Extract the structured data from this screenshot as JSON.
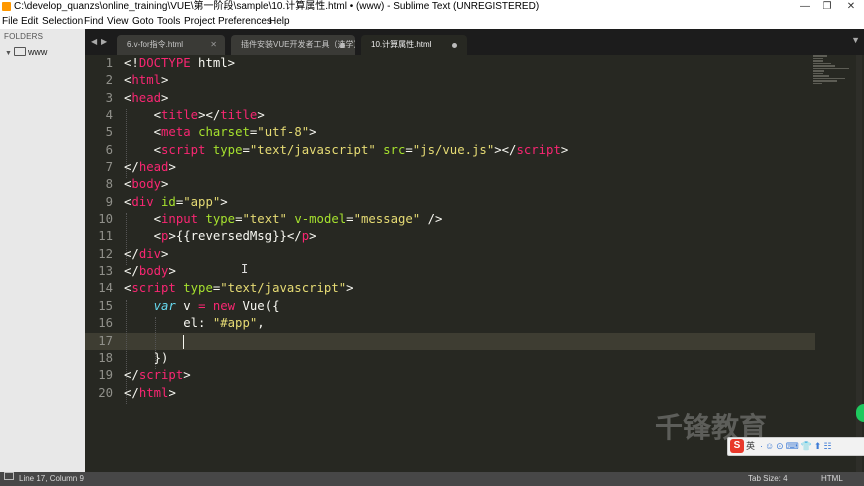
{
  "window": {
    "title": "C:\\develop_quanzs\\online_training\\VUE\\第一阶段\\sample\\10.计算属性.html • (www) - Sublime Text (UNREGISTERED)",
    "controls": [
      "—",
      "❐",
      "✕"
    ]
  },
  "menu": [
    "File",
    "Edit",
    "Selection",
    "Find",
    "View",
    "Goto",
    "Tools",
    "Project",
    "Preferences",
    "Help"
  ],
  "sidebar": {
    "header": "FOLDERS",
    "folder": "www"
  },
  "tabs": [
    {
      "label": "6.v-for指令.html",
      "state": "close"
    },
    {
      "label": "插件安装VUE开发者工具（选学）setter设置",
      "state": "modified"
    },
    {
      "label": "10.计算属性.html",
      "state": "modified-active"
    }
  ],
  "editor": {
    "line_numbers": [
      "1",
      "2",
      "3",
      "4",
      "5",
      "6",
      "7",
      "8",
      "9",
      "10",
      "11",
      "12",
      "13",
      "14",
      "15",
      "16",
      "17",
      "18",
      "19",
      "20"
    ],
    "current_line": 17
  },
  "status": {
    "position": "Line 17, Column 9",
    "tab_size": "Tab Size: 4",
    "syntax": "HTML"
  },
  "overlay": {
    "watermark": "千锋教育",
    "ime_logo": "S",
    "ime_lang": "英",
    "ime_icons": "·☺⊙⌨👕⬆☷"
  },
  "colors": {
    "tag": "#f92672",
    "attribute": "#a6e22e",
    "string": "#e6db74",
    "keyword": "#66d9ef",
    "background": "#272822"
  }
}
